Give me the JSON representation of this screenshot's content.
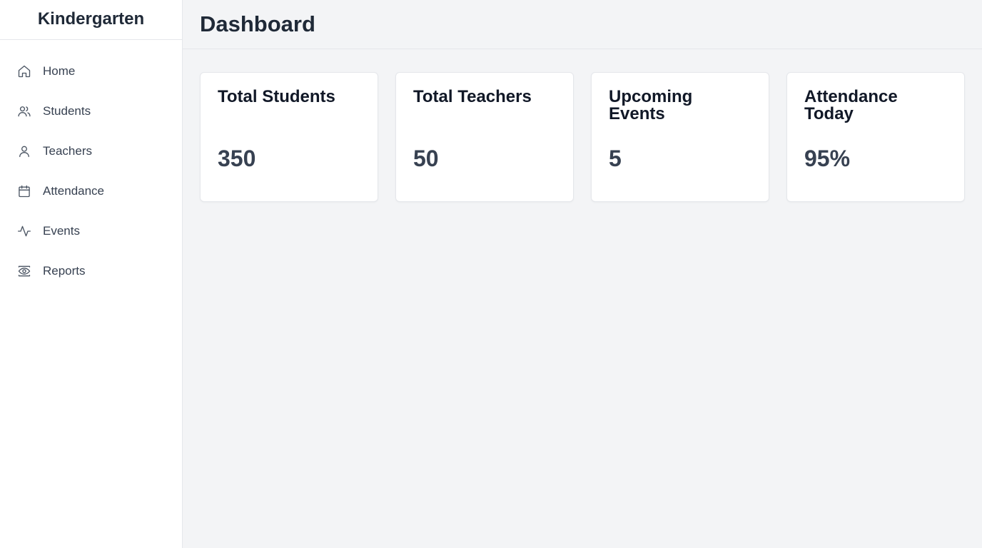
{
  "app": {
    "title": "Kindergarten"
  },
  "sidebar": {
    "items": [
      {
        "label": "Home",
        "icon": "home-icon"
      },
      {
        "label": "Students",
        "icon": "users-icon"
      },
      {
        "label": "Teachers",
        "icon": "user-icon"
      },
      {
        "label": "Attendance",
        "icon": "calendar-icon"
      },
      {
        "label": "Events",
        "icon": "activity-icon"
      },
      {
        "label": "Reports",
        "icon": "eye-icon"
      }
    ]
  },
  "header": {
    "title": "Dashboard"
  },
  "stats": [
    {
      "title": "Total Students",
      "value": "350"
    },
    {
      "title": "Total Teachers",
      "value": "50"
    },
    {
      "title": "Upcoming Events",
      "value": "5"
    },
    {
      "title": "Attendance Today",
      "value": "95%"
    }
  ],
  "colors": {
    "sidebar_bg": "#ffffff",
    "main_bg": "#f3f4f6",
    "text_dark": "#1f2937",
    "text_nav": "#374151"
  }
}
